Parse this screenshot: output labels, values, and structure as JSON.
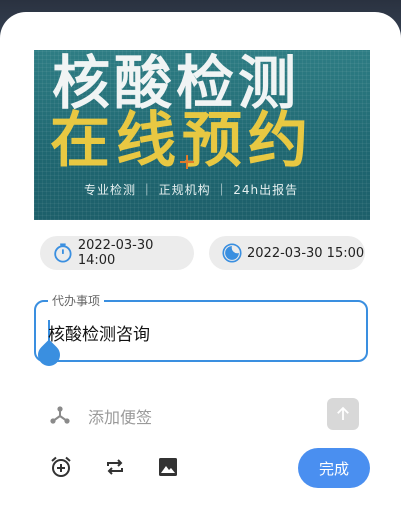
{
  "banner": {
    "title_line1": "核酸检测",
    "title_line2": "在线预约",
    "subtitle": "专业检测 ｜ 正规机构 ｜ 24h出报告"
  },
  "start_time": {
    "label": "2022-03-30 14:00",
    "icon": "stopwatch-icon"
  },
  "end_time": {
    "label": "2022-03-30 15:00",
    "icon": "moon-clock-icon"
  },
  "task_field": {
    "label": "代办事项",
    "value": "核酸检测咨询"
  },
  "note": {
    "placeholder": "添加便签",
    "icon": "share-nodes-icon"
  },
  "toolbar": {
    "alarm_icon": "alarm-add-icon",
    "repeat_icon": "repeat-icon",
    "image_icon": "image-icon",
    "done_label": "完成"
  },
  "colors": {
    "accent": "#3a8fe0",
    "done_button": "#4a8ff0"
  }
}
